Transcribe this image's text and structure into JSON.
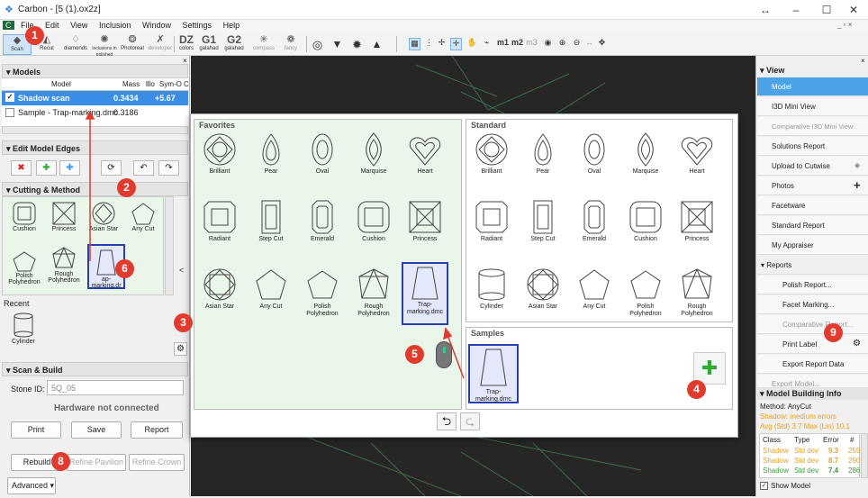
{
  "window": {
    "title": "Carbon - [5 (1).ox2z]",
    "restore_glyph": "↔",
    "min_glyph": "–",
    "max_glyph": "☐",
    "close_glyph": "✕"
  },
  "menu": [
    "File",
    "Edit",
    "View",
    "Inclusion",
    "Window",
    "Settings",
    "Help"
  ],
  "toolbar": {
    "items": [
      {
        "label": "Scan",
        "icon": "◆"
      },
      {
        "label": "Recut",
        "icon": "◭"
      },
      {
        "label": "diamonds",
        "icon": "♢"
      },
      {
        "label": "inclusions in polished",
        "icon": "✺"
      },
      {
        "label": "Photoreal",
        "icon": "❂"
      },
      {
        "label": "developer",
        "icon": "✗"
      }
    ],
    "dz": [
      {
        "big": "DZ",
        "small": "colors"
      },
      {
        "big": "G1",
        "small": "galahad"
      },
      {
        "big": "G2",
        "small": "galahad"
      },
      {
        "big": "✳",
        "small": "compass"
      },
      {
        "big": "❁",
        "small": "fancy"
      }
    ],
    "m_labels": [
      "m1",
      "m2",
      "m3"
    ]
  },
  "models": {
    "header": "Models",
    "columns": [
      "Model",
      "Mass",
      "lllo",
      "Sym-O",
      "C"
    ],
    "rows": [
      {
        "name": "Shadow scan",
        "mass": "0.3434",
        "sym": "+5.67"
      },
      {
        "name": "Sample - Trap-marking.dmc",
        "mass": "0.3186",
        "sym": ""
      }
    ]
  },
  "edit_edges": {
    "header": "Edit Model Edges"
  },
  "cutting": {
    "header": "Cutting & Method",
    "items": [
      "Cushion",
      "Princess",
      "Asian Star",
      "Any Cut",
      "Polish Polyhedron",
      "Rough Polyhedron",
      "ap-marking.dr"
    ],
    "recent_label": "Recent",
    "recent_item": "Cylinder"
  },
  "scan": {
    "header": "Scan & Build",
    "stone_id_label": "Stone ID:",
    "stone_id_value": "5Q_05",
    "hw_status": "Hardware not connected",
    "print": "Print",
    "save": "Save",
    "report": "Report",
    "rebuild": "Rebuild",
    "refine_pavilion": "Refine Pavilion",
    "refine_crown": "Refine Crown",
    "advanced": "Advanced"
  },
  "dialog": {
    "favorites_label": "Favorites",
    "standard_label": "Standard",
    "samples_label": "Samples",
    "favorites": [
      "Brilliant",
      "Pear",
      "Oval",
      "Marquise",
      "Heart",
      "Radiant",
      "Step Cut",
      "Emerald",
      "Cushion",
      "Princess",
      "Asian Star",
      "Any Cut",
      "Polish Polyhedron",
      "Rough Polyhedron",
      "Trap-marking.dmc"
    ],
    "standard": [
      "Brilliant",
      "Pear",
      "Oval",
      "Marquise",
      "Heart",
      "Radiant",
      "Step Cut",
      "Emerald",
      "Cushion",
      "Princess",
      "Cylinder",
      "Asian Star",
      "Any Cut",
      "Polish Polyhedron",
      "Rough Polyhedron"
    ],
    "sample": "Trap-marking.dmc"
  },
  "badges": [
    "1",
    "2",
    "3",
    "4",
    "5",
    "6",
    "8",
    "9"
  ],
  "view": {
    "header": "View",
    "items": [
      "Model",
      "I3D Mini View",
      "Comparative I3D Mini View",
      "Solutions Report",
      "Upload to Cutwise",
      "Photos",
      "Facetware",
      "Standard Report",
      "My Appraiser"
    ],
    "reports_header": "Reports",
    "reports": [
      "Polish Report...",
      "Facet Marking...",
      "Comparative Report...",
      "Print Label",
      "Export Report Data"
    ],
    "export_model": "Export Model..."
  },
  "mbi": {
    "header": "Model Building Info",
    "method": "Method: AnyCut",
    "warn": "Shadow: medium errors",
    "avg": "Avg (Std) 3.7  Max (Lin) 10.1",
    "columns": [
      "Class",
      "Type",
      "Error",
      "#"
    ],
    "rows": [
      {
        "class": "Shadow",
        "type": "Std dev",
        "error": "9.3",
        "n": "259"
      },
      {
        "class": "Shadow",
        "type": "Std dev",
        "error": "8.7",
        "n": "290"
      },
      {
        "class": "Shadow",
        "type": "Std dev",
        "error": "7.4",
        "n": "286"
      }
    ],
    "show_model": "Show Model"
  }
}
